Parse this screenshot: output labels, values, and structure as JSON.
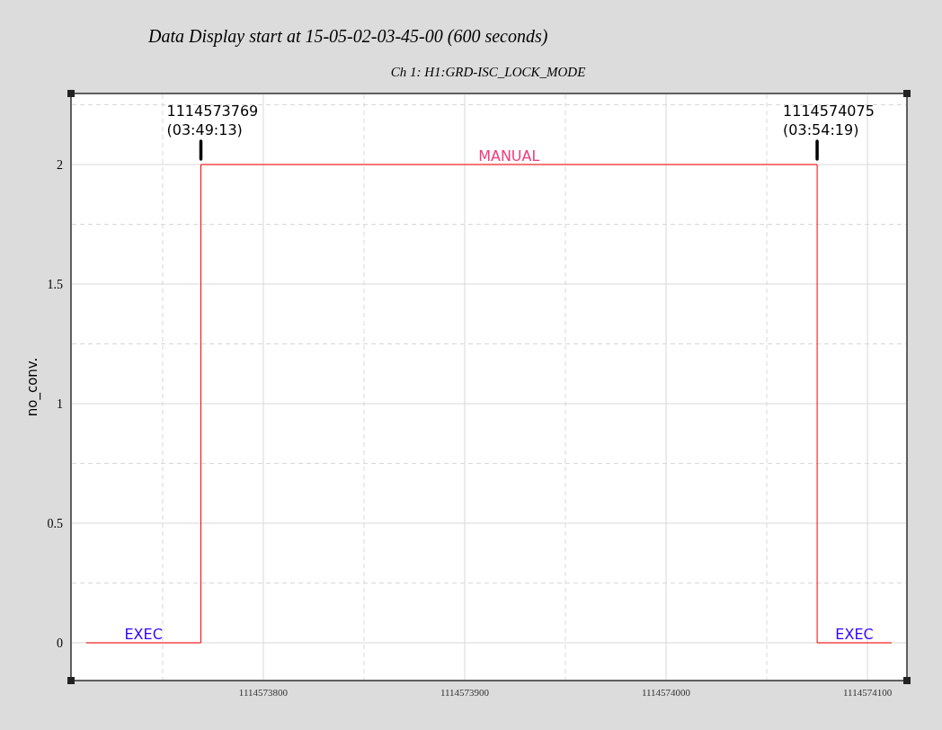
{
  "heading": "Data Display start at 15-05-02-03-45-00 (600 seconds)",
  "plot": {
    "chart_data": {
      "type": "line",
      "title": "Ch 1: H1:GRD-ISC_LOCK_MODE",
      "ylabel": "no_conv.",
      "x": [
        1114573712,
        1114573769,
        1114573769,
        1114574075,
        1114574075,
        1114574112
      ],
      "series": [
        {
          "color": "#ff0000",
          "values": [
            0,
            0,
            2,
            2,
            0,
            0
          ]
        }
      ],
      "grid": true,
      "xlim": [
        1114573704.5,
        1114574119.6
      ],
      "ylim": [
        -0.158,
        2.297
      ],
      "xticks": [
        1114573800,
        1114573900,
        1114574000,
        1114574100
      ],
      "yticks": [
        0,
        0.5,
        1,
        1.5,
        2
      ],
      "annotations": [
        {
          "text": "1114573769\n(03:49:13)"
        },
        {
          "text": "1114574075\n(03:54:19)"
        }
      ]
    },
    "state_labels": [
      {
        "text": "EXEC",
        "color": "#3300ff"
      },
      {
        "text": "MANUAL",
        "color": "#ee3d7a"
      },
      {
        "text": "EXEC",
        "color": "#3300ff"
      }
    ]
  }
}
